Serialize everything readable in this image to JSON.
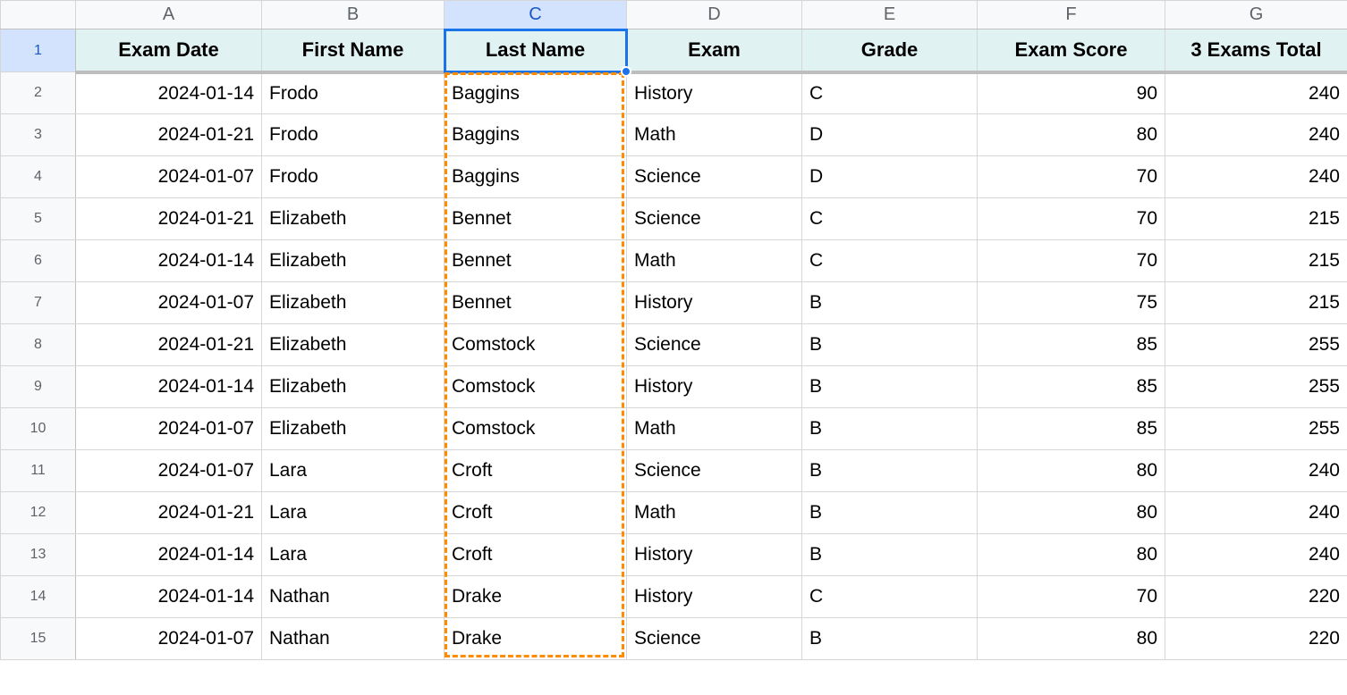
{
  "columns": [
    "A",
    "B",
    "C",
    "D",
    "E",
    "F",
    "G"
  ],
  "active_column_index": 2,
  "active_row_index": 0,
  "headers": {
    "A": "Exam Date",
    "B": "First Name",
    "C": "Last Name",
    "D": "Exam",
    "E": "Grade",
    "F": "Exam Score",
    "G": "3 Exams Total"
  },
  "rows": [
    {
      "n": 2,
      "A": "2024-01-14",
      "B": "Frodo",
      "C": "Baggins",
      "D": "History",
      "E": "C",
      "F": "90",
      "G": "240"
    },
    {
      "n": 3,
      "A": "2024-01-21",
      "B": "Frodo",
      "C": "Baggins",
      "D": "Math",
      "E": "D",
      "F": "80",
      "G": "240"
    },
    {
      "n": 4,
      "A": "2024-01-07",
      "B": "Frodo",
      "C": "Baggins",
      "D": "Science",
      "E": "D",
      "F": "70",
      "G": "240"
    },
    {
      "n": 5,
      "A": "2024-01-21",
      "B": "Elizabeth",
      "C": "Bennet",
      "D": "Science",
      "E": "C",
      "F": "70",
      "G": "215"
    },
    {
      "n": 6,
      "A": "2024-01-14",
      "B": "Elizabeth",
      "C": "Bennet",
      "D": "Math",
      "E": "C",
      "F": "70",
      "G": "215"
    },
    {
      "n": 7,
      "A": "2024-01-07",
      "B": "Elizabeth",
      "C": "Bennet",
      "D": "History",
      "E": "B",
      "F": "75",
      "G": "215"
    },
    {
      "n": 8,
      "A": "2024-01-21",
      "B": "Elizabeth",
      "C": "Comstock",
      "D": "Science",
      "E": "B",
      "F": "85",
      "G": "255"
    },
    {
      "n": 9,
      "A": "2024-01-14",
      "B": "Elizabeth",
      "C": "Comstock",
      "D": "History",
      "E": "B",
      "F": "85",
      "G": "255"
    },
    {
      "n": 10,
      "A": "2024-01-07",
      "B": "Elizabeth",
      "C": "Comstock",
      "D": "Math",
      "E": "B",
      "F": "85",
      "G": "255"
    },
    {
      "n": 11,
      "A": "2024-01-07",
      "B": "Lara",
      "C": "Croft",
      "D": "Science",
      "E": "B",
      "F": "80",
      "G": "240"
    },
    {
      "n": 12,
      "A": "2024-01-21",
      "B": "Lara",
      "C": "Croft",
      "D": "Math",
      "E": "B",
      "F": "80",
      "G": "240"
    },
    {
      "n": 13,
      "A": "2024-01-14",
      "B": "Lara",
      "C": "Croft",
      "D": "History",
      "E": "B",
      "F": "80",
      "G": "240"
    },
    {
      "n": 14,
      "A": "2024-01-14",
      "B": "Nathan",
      "C": "Drake",
      "D": "History",
      "E": "C",
      "F": "70",
      "G": "220"
    },
    {
      "n": 15,
      "A": "2024-01-07",
      "B": "Nathan",
      "C": "Drake",
      "D": "Science",
      "E": "B",
      "F": "80",
      "G": "220"
    }
  ],
  "align": {
    "A": "right",
    "B": "left",
    "C": "left",
    "D": "left",
    "E": "left",
    "F": "right",
    "G": "right"
  },
  "selection": {
    "cell": "C1"
  },
  "copy_marquee": {
    "col": "C",
    "from_row": 2,
    "to_row": 15
  }
}
